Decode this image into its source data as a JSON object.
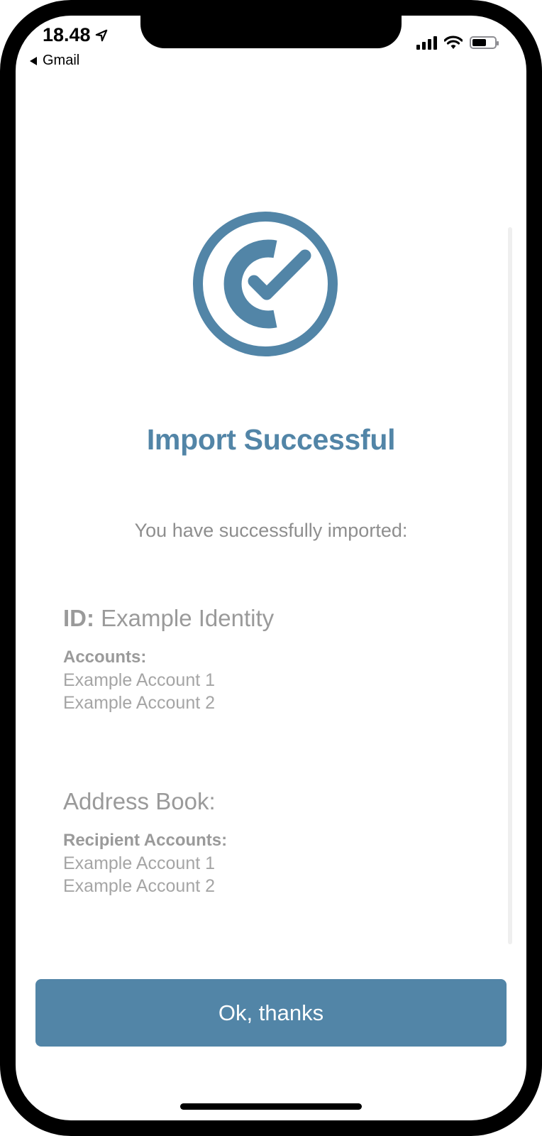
{
  "status_bar": {
    "time": "18.48",
    "back_app": "Gmail"
  },
  "logo_icon": "check-circle-logo",
  "accent_color": "#5285a7",
  "title": "Import Successful",
  "subtitle": "You have successfully imported:",
  "identity": {
    "label": "ID:",
    "value": "Example Identity",
    "accounts_label": "Accounts:",
    "accounts": [
      "Example Account 1",
      "Example Account 2"
    ]
  },
  "address_book": {
    "title": "Address Book:",
    "recipients_label": "Recipient Accounts:",
    "recipients": [
      "Example Account 1",
      "Example Account 2"
    ]
  },
  "ok_button_label": "Ok, thanks"
}
